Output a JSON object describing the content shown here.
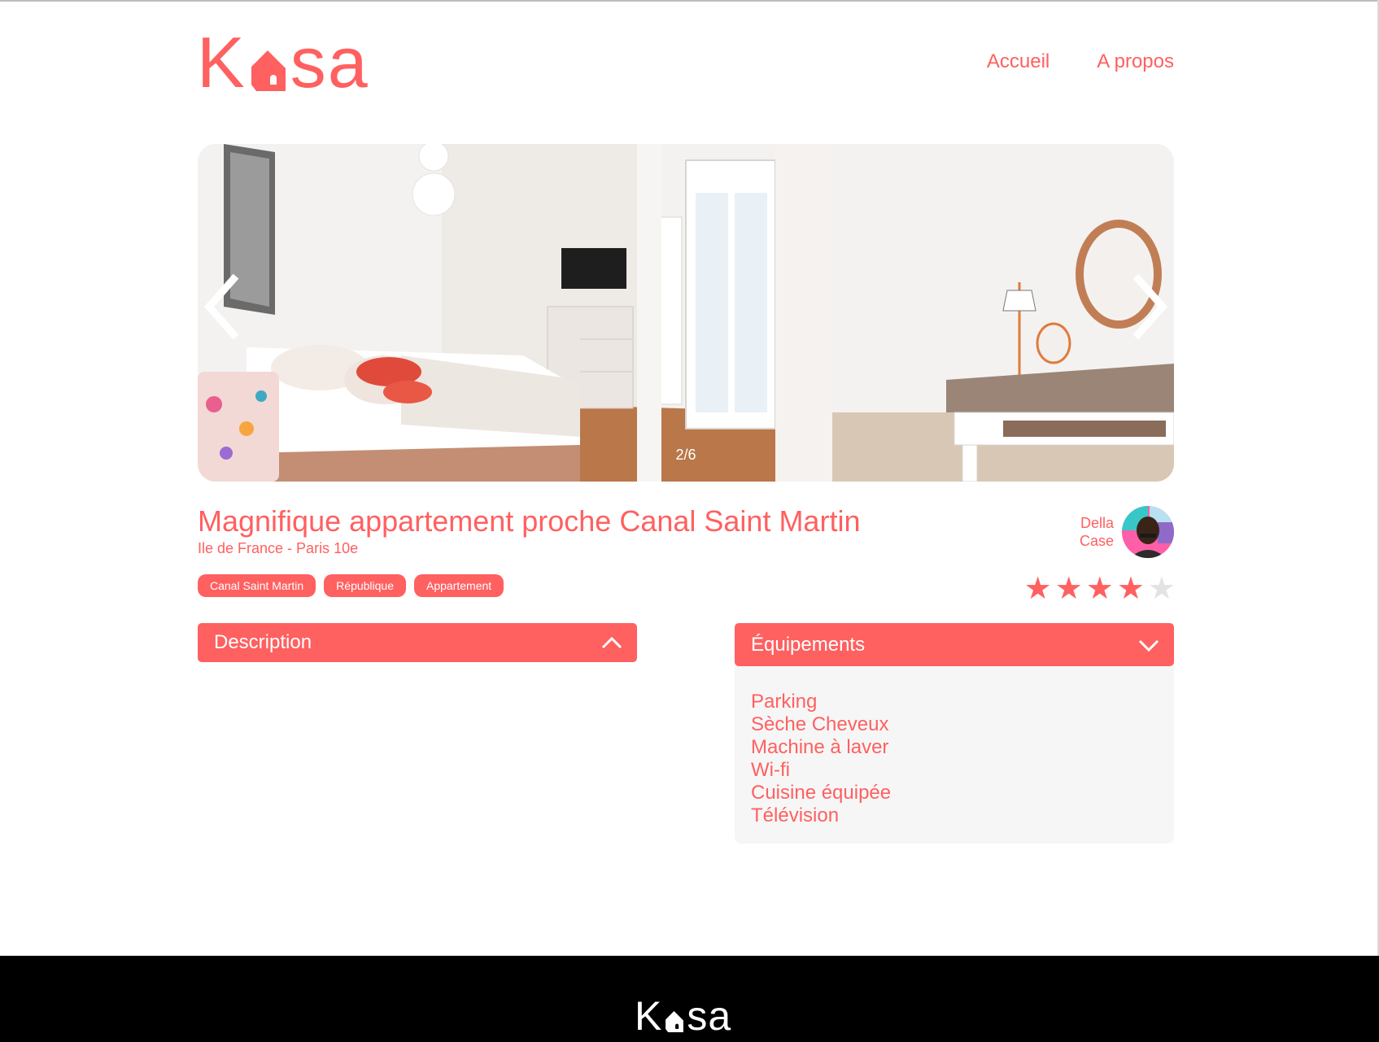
{
  "header": {
    "logo": "Kasa",
    "nav": [
      {
        "label": "Accueil"
      },
      {
        "label": "A propos"
      }
    ]
  },
  "carousel": {
    "counter": "2/6"
  },
  "listing": {
    "title": "Magnifique appartement proche Canal Saint Martin",
    "location": "Ile de France - Paris 10e",
    "tags": [
      "Canal Saint Martin",
      "République",
      "Appartement"
    ],
    "host": {
      "first_name": "Della",
      "last_name": "Case"
    },
    "rating": 4,
    "rating_max": 5
  },
  "description": {
    "label": "Description"
  },
  "equipments": {
    "label": "Équipements",
    "items": [
      "Parking",
      "Sèche Cheveux",
      "Machine à laver",
      "Wi-fi",
      "Cuisine équipée",
      "Télévision"
    ]
  },
  "footer": {
    "logo": "Kasa"
  },
  "colors": {
    "accent": "#ff6060",
    "star_off": "#e3e3e3",
    "panel_bg": "#f6f6f6",
    "footer_bg": "#000000"
  }
}
